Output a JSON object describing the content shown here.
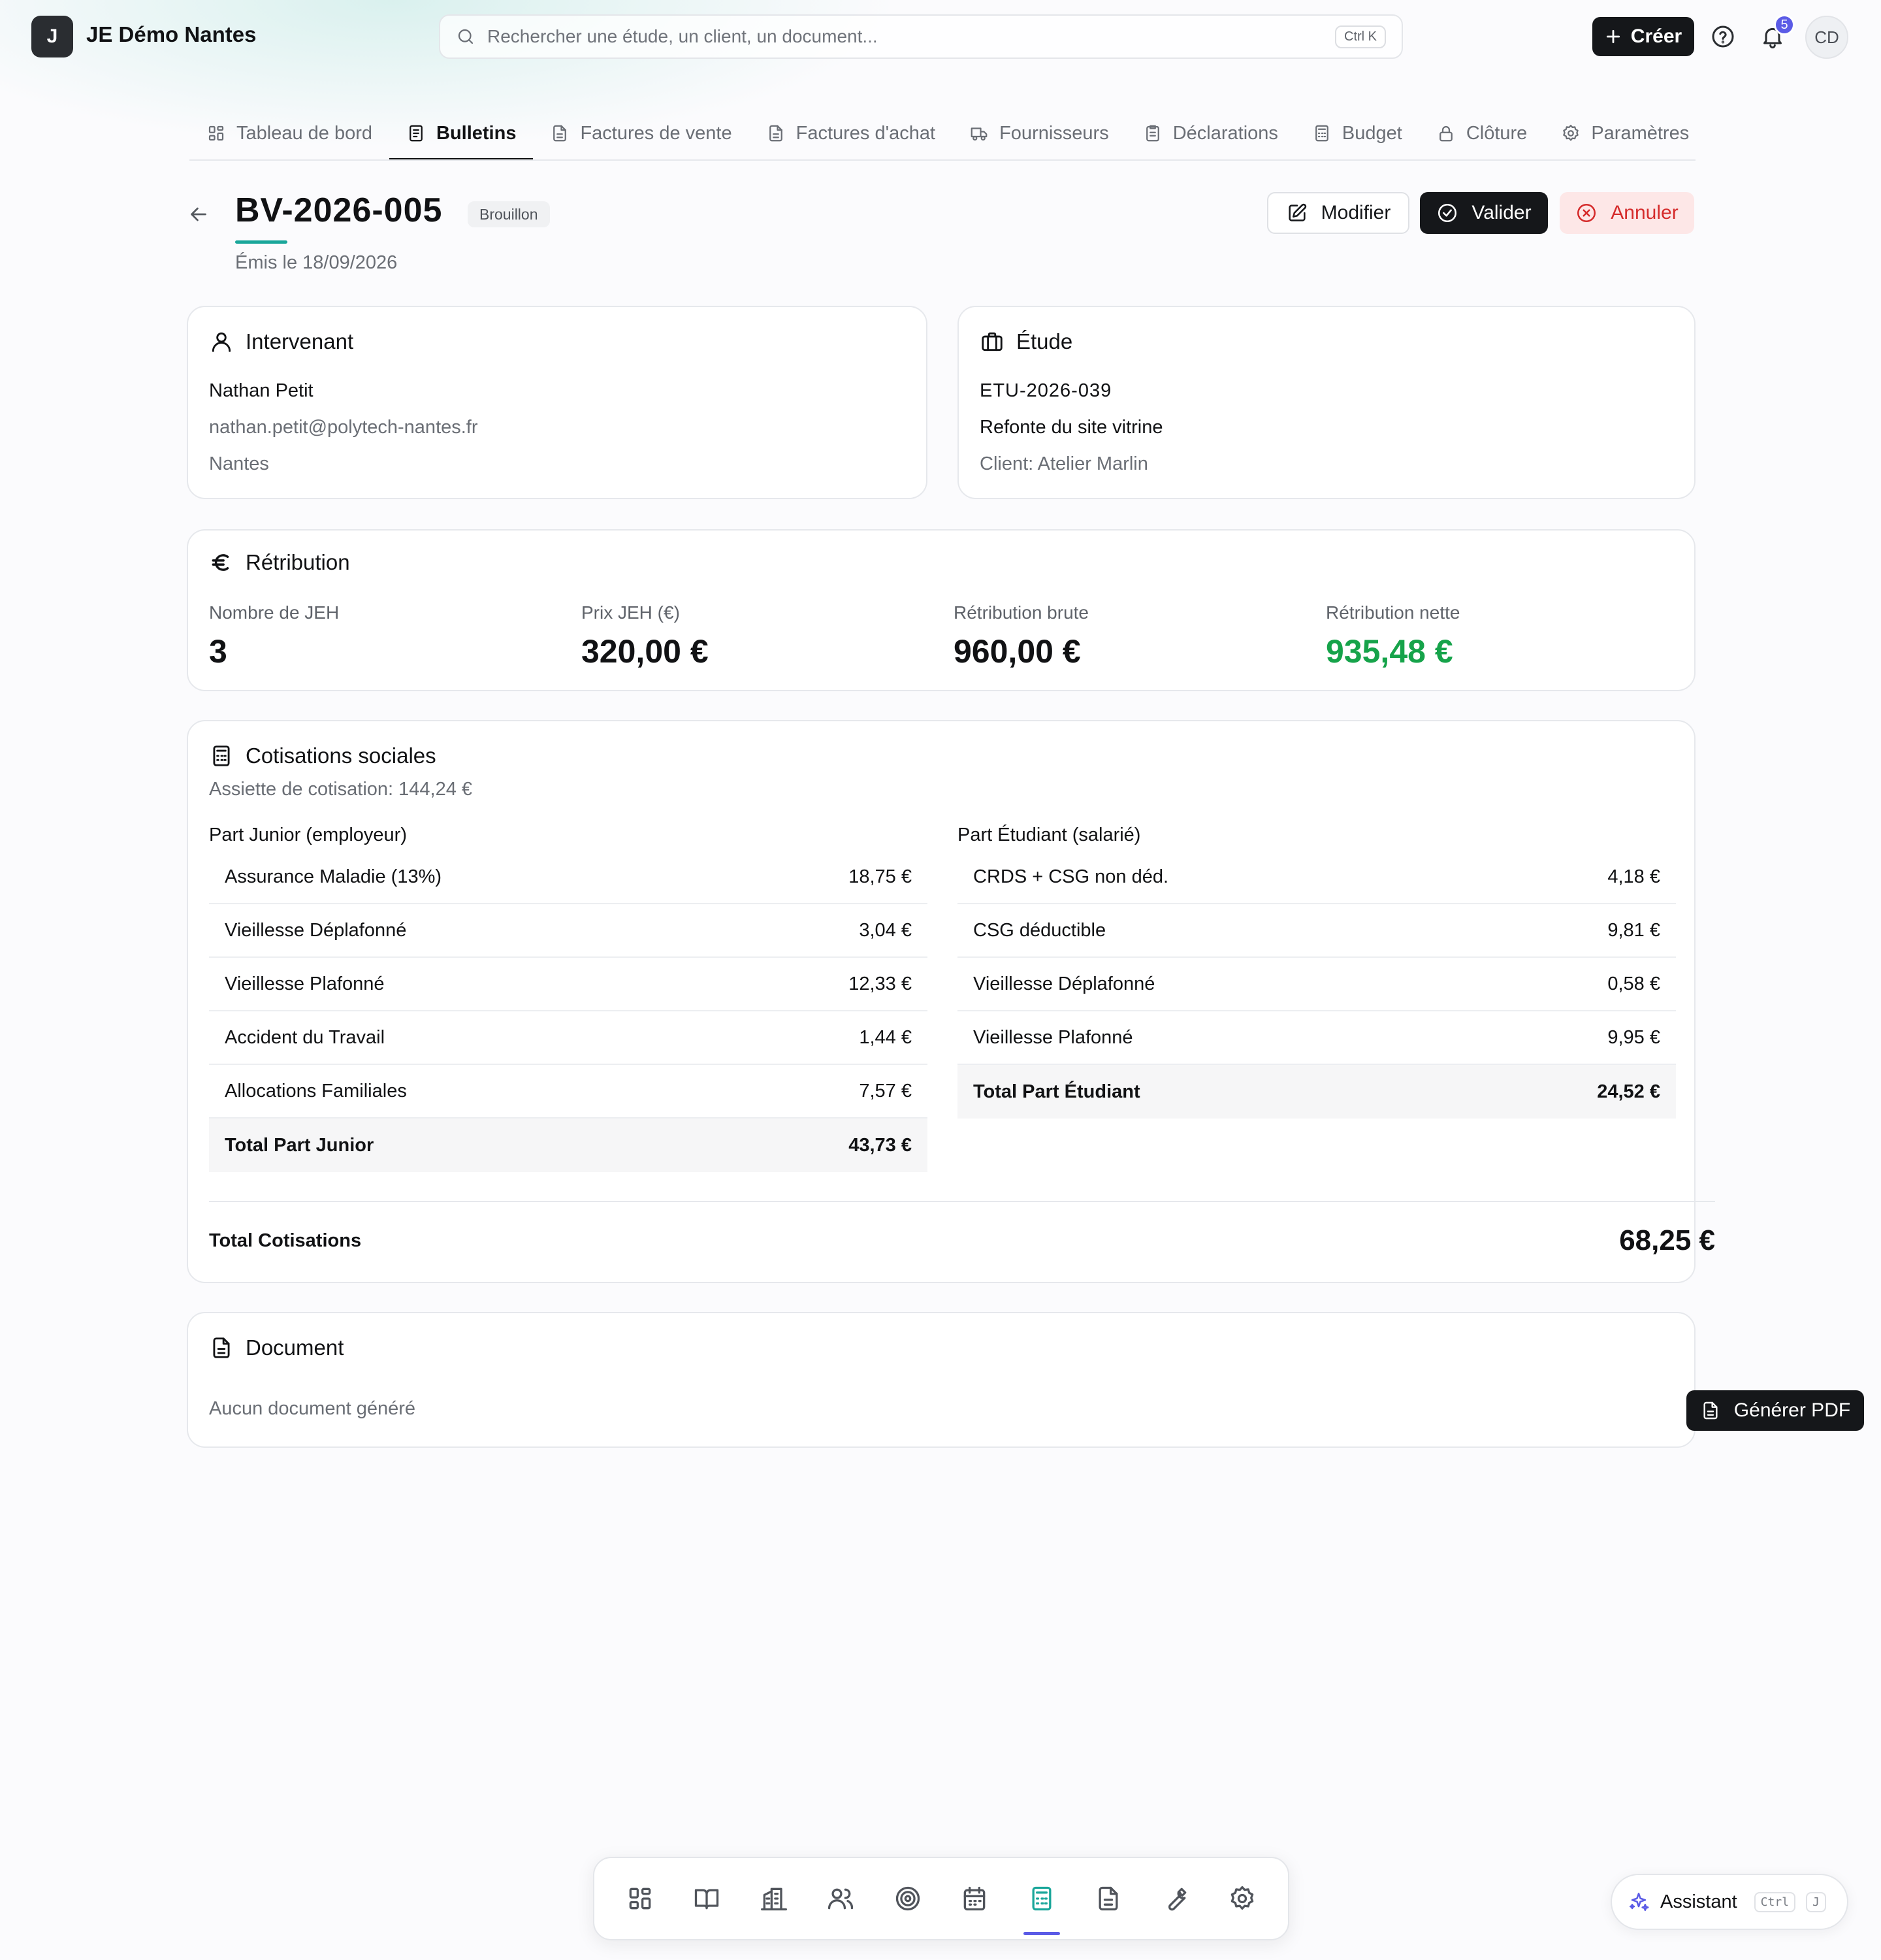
{
  "topbar": {
    "logo_letter": "J",
    "org_name": "JE Démo Nantes",
    "search_placeholder": "Rechercher une étude, un client, un document...",
    "search_shortcut": "Ctrl K",
    "create_label": "Créer",
    "notifications_count": "5",
    "avatar_initials": "CD"
  },
  "tabs": [
    {
      "label": "Tableau de bord",
      "icon": "layout-grid-icon",
      "active": false
    },
    {
      "label": "Bulletins",
      "icon": "file-list-icon",
      "active": true
    },
    {
      "label": "Factures de vente",
      "icon": "file-text-icon",
      "active": false
    },
    {
      "label": "Factures d'achat",
      "icon": "file-text-icon",
      "active": false
    },
    {
      "label": "Fournisseurs",
      "icon": "truck-icon",
      "active": false
    },
    {
      "label": "Déclarations",
      "icon": "clipboard-icon",
      "active": false
    },
    {
      "label": "Budget",
      "icon": "calculator-icon",
      "active": false
    },
    {
      "label": "Clôture",
      "icon": "lock-icon",
      "active": false
    },
    {
      "label": "Paramètres",
      "icon": "gear-icon",
      "active": false
    }
  ],
  "header": {
    "title": "BV-2026-005",
    "status": "Brouillon",
    "issued": "Émis le 18/09/2026",
    "edit_label": "Modifier",
    "validate_label": "Valider",
    "cancel_label": "Annuler"
  },
  "intervenant": {
    "title": "Intervenant",
    "name": "Nathan Petit",
    "email": "nathan.petit@polytech-nantes.fr",
    "city": "Nantes"
  },
  "etude": {
    "title": "Étude",
    "ref": "ETU-2026-039",
    "name": "Refonte du site vitrine",
    "client": "Client: Atelier Marlin"
  },
  "retribution": {
    "title": "Rétribution",
    "jeh_label": "Nombre de JEH",
    "jeh_value": "3",
    "price_label": "Prix JEH (€)",
    "price_value": "320,00 €",
    "gross_label": "Rétribution brute",
    "gross_value": "960,00 €",
    "net_label": "Rétribution nette",
    "net_value": "935,48 €",
    "net_color": "#16a34a"
  },
  "cotisations": {
    "title": "Cotisations sociales",
    "assiette": "Assiette de cotisation: 144,24 €",
    "junior": {
      "title": "Part Junior (employeur)",
      "rows": [
        {
          "label": "Assurance Maladie (13%)",
          "value": "18,75 €"
        },
        {
          "label": "Vieillesse Déplafonné",
          "value": "3,04 €"
        },
        {
          "label": "Vieillesse Plafonné",
          "value": "12,33 €"
        },
        {
          "label": "Accident du Travail",
          "value": "1,44 €"
        },
        {
          "label": "Allocations Familiales",
          "value": "7,57 €"
        }
      ],
      "total_label": "Total Part Junior",
      "total_value": "43,73 €"
    },
    "etudiant": {
      "title": "Part Étudiant (salarié)",
      "rows": [
        {
          "label": "CRDS + CSG non déd.",
          "value": "4,18 €"
        },
        {
          "label": "CSG déductible",
          "value": "9,81 €"
        },
        {
          "label": "Vieillesse Déplafonné",
          "value": "0,58 €"
        },
        {
          "label": "Vieillesse Plafonné",
          "value": "9,95 €"
        }
      ],
      "total_label": "Total Part Étudiant",
      "total_value": "24,52 €"
    },
    "total_label": "Total Cotisations",
    "total_value": "68,25 €"
  },
  "document": {
    "title": "Document",
    "empty": "Aucun document généré",
    "generate_label": "Générer PDF"
  },
  "dock": [
    {
      "name": "dashboard",
      "icon": "layout-grid-icon",
      "active": false
    },
    {
      "name": "book",
      "icon": "book-icon",
      "active": false
    },
    {
      "name": "buildings",
      "icon": "building-icon",
      "active": false
    },
    {
      "name": "users",
      "icon": "users-icon",
      "active": false
    },
    {
      "name": "target",
      "icon": "target-icon",
      "active": false
    },
    {
      "name": "calendar",
      "icon": "calendar-icon",
      "active": false
    },
    {
      "name": "finance",
      "icon": "calculator-icon",
      "active": true
    },
    {
      "name": "documents",
      "icon": "file-text-icon",
      "active": false
    },
    {
      "name": "tools",
      "icon": "wrench-icon",
      "active": false
    },
    {
      "name": "settings",
      "icon": "gear-icon",
      "active": false
    }
  ],
  "assistant": {
    "label": "Assistant",
    "key1": "Ctrl",
    "key2": "J",
    "accent": "#5b5be6"
  },
  "colors": {
    "accent_teal": "#19a69a",
    "primary_dark": "#15171a",
    "danger": "#d52b2b"
  }
}
